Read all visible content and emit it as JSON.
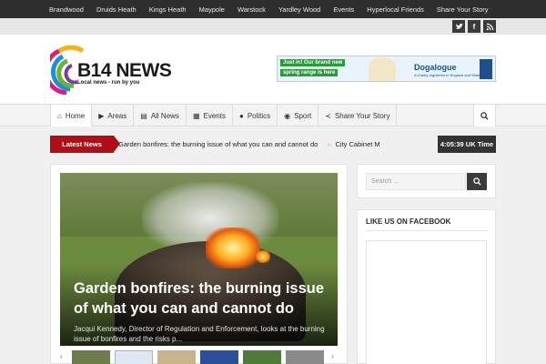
{
  "topnav": [
    "Brandwood",
    "Druids Heath",
    "Kings Heath",
    "Maypole",
    "Warstock",
    "Yardley Wood",
    "Events",
    "Hyperlocal Friends",
    "Share Your Story"
  ],
  "social": {
    "twitter": "t",
    "facebook": "f",
    "rss": "r"
  },
  "logo": {
    "title": "B14 NEWS",
    "tagline": "Local news - run by you"
  },
  "ad": {
    "tag1": "Just in! Our brand new",
    "tag2": "spring range is here",
    "brand": "Dogalogue",
    "sub": "A charity registered in England and Wales"
  },
  "mainnav": [
    {
      "icon": "⌂",
      "label": "Home"
    },
    {
      "icon": "▶",
      "label": "Areas"
    },
    {
      "icon": "▤",
      "label": "All News"
    },
    {
      "icon": "▦",
      "label": "Events"
    },
    {
      "icon": "●",
      "label": "Politics"
    },
    {
      "icon": "◉",
      "label": "Sport"
    },
    {
      "icon": "≺",
      "label": "Share Your Story"
    }
  ],
  "ticker": {
    "label": "Latest News",
    "items": [
      "Garden bonfires: the burning issue of what you can and cannot do",
      "City Cabinet Me"
    ]
  },
  "clock": "4:05:39 UK Time",
  "feature": {
    "title": "Garden bonfires: the burning issue of what you can and cannot do",
    "excerpt": "Jacqui Kennedy, Director of Regulation and Enforcement, looks at the burning issue of bonfires and the risks p..."
  },
  "sidebar": {
    "search_placeholder": "Search ...",
    "facebook_heading": "LIKE US ON FACEBOOK"
  },
  "colors": {
    "accent": "#b10d16",
    "dark": "#2e2e2e"
  }
}
